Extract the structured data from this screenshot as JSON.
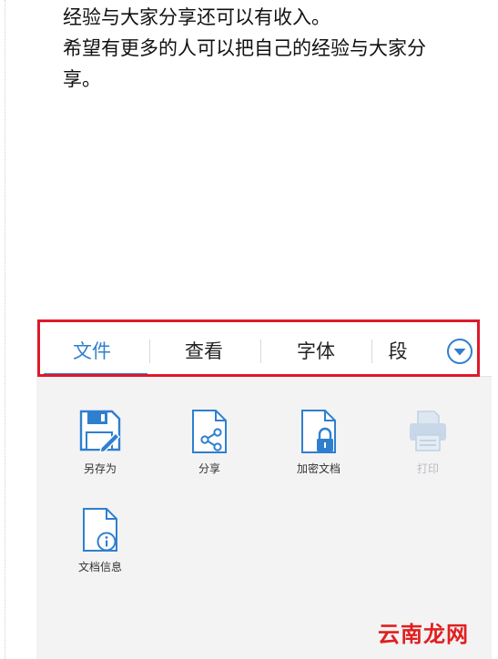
{
  "document": {
    "lines": [
      "经验与大家分享还可以有收入。",
      "希望有更多的人可以把自己的经验与大家分",
      "享。"
    ]
  },
  "toolbar": {
    "tabs": [
      {
        "label": "文件",
        "active": true
      },
      {
        "label": "查看",
        "active": false
      },
      {
        "label": "字体",
        "active": false
      },
      {
        "label": "段",
        "active": false
      }
    ],
    "more_icon": "chevron-down-circle-icon",
    "accent_color": "#2f7fd0",
    "highlight_color": "#e0182a"
  },
  "panel": {
    "tools": [
      {
        "label": "另存为",
        "icon": "save-as-icon",
        "enabled": true
      },
      {
        "label": "分享",
        "icon": "share-icon",
        "enabled": true
      },
      {
        "label": "加密文档",
        "icon": "lock-document-icon",
        "enabled": true
      },
      {
        "label": "打印",
        "icon": "print-icon",
        "enabled": false
      },
      {
        "label": "文档信息",
        "icon": "document-info-icon",
        "enabled": true
      }
    ]
  },
  "watermark": {
    "text": "云南龙网",
    "color": "#e0201f"
  }
}
